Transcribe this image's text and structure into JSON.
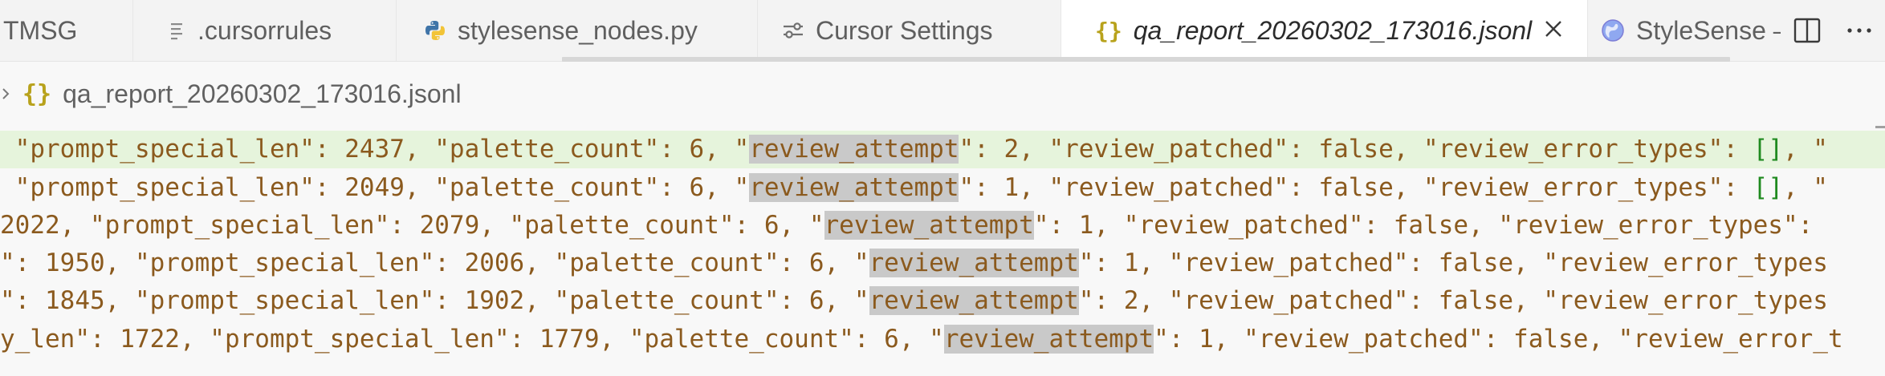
{
  "tabs": [
    {
      "label": "TMSG",
      "icon": "none"
    },
    {
      "label": ".cursorrules",
      "icon": "lines-file-icon"
    },
    {
      "label": "stylesense_nodes.py",
      "icon": "python-icon"
    },
    {
      "label": "Cursor Settings",
      "icon": "settings-sliders-icon"
    },
    {
      "label": "qa_report_20260302_173016.jsonl",
      "icon": "json-braces-icon",
      "active": true
    },
    {
      "label": "StyleSense –",
      "icon": "globe-icon"
    }
  ],
  "breadcrumb": {
    "icon_text": "{}",
    "file": "qa_report_20260302_173016.jsonl"
  },
  "editor": {
    "lines": [
      {
        "current": true,
        "parts": [
          {
            "t": " \"prompt_special_len\": 2437, \"palette_count\": 6, \""
          },
          {
            "t": "review_attempt",
            "hl": true
          },
          {
            "t": "\": 2, \"review_patched\": false, \"review_error_types\": "
          },
          {
            "t": "[]",
            "cls": "br"
          },
          {
            "t": ", \""
          }
        ]
      },
      {
        "parts": [
          {
            "t": " \"prompt_special_len\": 2049, \"palette_count\": 6, \""
          },
          {
            "t": "review_attempt",
            "hl": true
          },
          {
            "t": "\": 1, \"review_patched\": false, \"review_error_types\": "
          },
          {
            "t": "[]",
            "cls": "br"
          },
          {
            "t": ", \""
          }
        ]
      },
      {
        "parts": [
          {
            "t": "2022, \"prompt_special_len\": 2079, \"palette_count\": 6, \""
          },
          {
            "t": "review_attempt",
            "hl": true
          },
          {
            "t": "\": 1, \"review_patched\": false, \"review_error_types\": "
          }
        ]
      },
      {
        "parts": [
          {
            "t": "\": 1950, \"prompt_special_len\": 2006, \"palette_count\": 6, \""
          },
          {
            "t": "review_attempt",
            "hl": true
          },
          {
            "t": "\": 1, \"review_patched\": false, \"review_error_types"
          }
        ]
      },
      {
        "parts": [
          {
            "t": "\": 1845, \"prompt_special_len\": 1902, \"palette_count\": 6, \""
          },
          {
            "t": "review_attempt",
            "hl": true
          },
          {
            "t": "\": 2, \"review_patched\": false, \"review_error_types"
          }
        ]
      },
      {
        "parts": [
          {
            "t": "y_len\": 1722, \"prompt_special_len\": 1779, \"palette_count\": 6, \""
          },
          {
            "t": "review_attempt",
            "hl": true
          },
          {
            "t": "\": 1, \"review_patched\": false, \"review_error_t"
          }
        ]
      }
    ]
  }
}
